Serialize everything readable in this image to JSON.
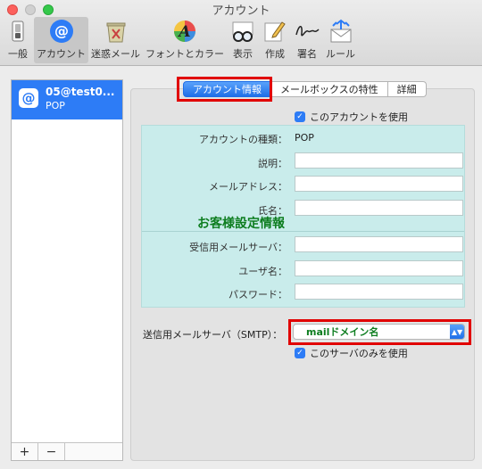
{
  "window": {
    "title": "アカウント"
  },
  "toolbar": {
    "items": [
      {
        "label": "一般",
        "icon": "switch-icon"
      },
      {
        "label": "アカウント",
        "icon": "at-sign-icon"
      },
      {
        "label": "迷惑メール",
        "icon": "junk-trash-icon"
      },
      {
        "label": "フォントとカラー",
        "icon": "fonts-colors-icon"
      },
      {
        "label": "表示",
        "icon": "glasses-icon"
      },
      {
        "label": "作成",
        "icon": "compose-pencil-icon"
      },
      {
        "label": "署名",
        "icon": "signature-icon"
      },
      {
        "label": "ルール",
        "icon": "rules-envelope-icon"
      }
    ],
    "selected": "アカウント"
  },
  "sidebar": {
    "account": {
      "name": "05@test0...",
      "type": "POP"
    },
    "add_label": "+",
    "remove_label": "−"
  },
  "tabs": {
    "account_info": "アカウント情報",
    "mailbox_behaviors": "メールボックスの特性",
    "advanced": "詳細",
    "selected": "アカウント情報"
  },
  "account_info": {
    "use_account_label": "このアカウントを使用",
    "use_account_checked": true,
    "account_type_label": "アカウントの種類：",
    "account_type_value": "POP",
    "description_label": "説明：",
    "description_value": "",
    "email_label": "メールアドレス：",
    "email_value": "",
    "full_name_label": "氏名：",
    "full_name_value": "",
    "overlay_text": "お客様設定情報",
    "incoming_server_label": "受信用メールサーバ：",
    "incoming_server_value": "",
    "username_label": "ユーザ名：",
    "username_value": "",
    "password_label": "パスワード：",
    "password_value": "",
    "smtp_label": "送信用メールサーバ（SMTP）：",
    "smtp_value": "mailドメイン名",
    "use_only_server_label": "このサーバのみを使用",
    "use_only_server_checked": true
  },
  "colors": {
    "accent": "#2d7cf6",
    "highlight_box": "#e10000",
    "teal_overlay": "#c9eceb",
    "annotation_text": "#0d7d1f"
  }
}
